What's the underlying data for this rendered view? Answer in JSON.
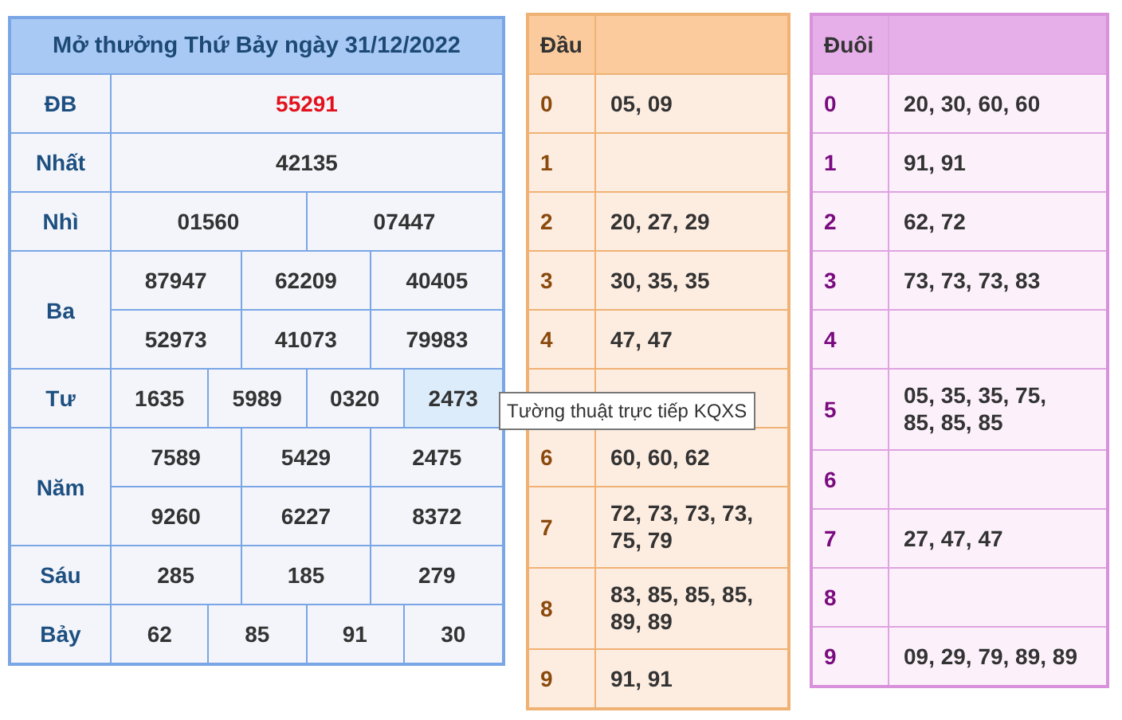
{
  "results": {
    "title": "Mở thưởng Thứ Bảy ngày 31/12/2022",
    "rows": [
      {
        "label": "ĐB",
        "kind": "special",
        "lines": [
          [
            {
              "value": "55291"
            }
          ]
        ]
      },
      {
        "label": "Nhất",
        "kind": "regular",
        "lines": [
          [
            {
              "value": "42135"
            }
          ]
        ]
      },
      {
        "label": "Nhì",
        "kind": "regular",
        "lines": [
          [
            {
              "value": "01560"
            },
            {
              "value": "07447"
            }
          ]
        ]
      },
      {
        "label": "Ba",
        "kind": "regular",
        "lines": [
          [
            {
              "value": "87947"
            },
            {
              "value": "62209"
            },
            {
              "value": "40405"
            }
          ],
          [
            {
              "value": "52973"
            },
            {
              "value": "41073"
            },
            {
              "value": "79983"
            }
          ]
        ]
      },
      {
        "label": "Tư",
        "kind": "regular",
        "lines": [
          [
            {
              "value": "1635",
              "highlighted": false
            },
            {
              "value": "5989",
              "highlighted": false
            },
            {
              "value": "0320",
              "highlighted": false
            },
            {
              "value": "2473",
              "highlighted": true
            }
          ]
        ]
      },
      {
        "label": "Năm",
        "kind": "regular",
        "lines": [
          [
            {
              "value": "7589"
            },
            {
              "value": "5429"
            },
            {
              "value": "2475"
            }
          ],
          [
            {
              "value": "9260"
            },
            {
              "value": "6227"
            },
            {
              "value": "8372"
            }
          ]
        ]
      },
      {
        "label": "Sáu",
        "kind": "regular",
        "lines": [
          [
            {
              "value": "285"
            },
            {
              "value": "185"
            },
            {
              "value": "279"
            }
          ]
        ]
      },
      {
        "label": "Bảy",
        "kind": "regular",
        "lines": [
          [
            {
              "value": "62"
            },
            {
              "value": "85"
            },
            {
              "value": "91"
            },
            {
              "value": "30"
            }
          ]
        ]
      }
    ]
  },
  "loto_tables": [
    {
      "kind": "head",
      "title": "Đầu",
      "rows": [
        {
          "digit": "0",
          "numbers": "05, 09"
        },
        {
          "digit": "1"
        },
        {
          "digit": "2",
          "numbers": "20, 27, 29"
        },
        {
          "digit": "3",
          "numbers": "30, 35, 35"
        },
        {
          "digit": "4",
          "numbers": "47, 47"
        },
        {},
        {
          "digit": "6",
          "numbers": "60, 60, 62"
        },
        {
          "digit": "7",
          "numbers": "72, 73, 73, 73, 75, 79"
        },
        {
          "digit": "8",
          "numbers": "83, 85, 85, 85, 89, 89"
        },
        {
          "digit": "9",
          "numbers": "91, 91"
        }
      ]
    },
    {
      "kind": "tail",
      "title": "Đuôi",
      "rows": [
        {
          "digit": "0",
          "numbers": "20, 30, 60, 60"
        },
        {
          "digit": "1",
          "numbers": "91, 91"
        },
        {
          "digit": "2",
          "numbers": "62, 72"
        },
        {
          "digit": "3",
          "numbers": "73, 73, 73, 83"
        },
        {
          "digit": "4"
        },
        {
          "digit": "5",
          "numbers": "05, 35, 35, 75, 85, 85, 85"
        },
        {
          "digit": "6"
        },
        {
          "digit": "7",
          "numbers": "27, 47, 47"
        },
        {
          "digit": "8"
        },
        {
          "digit": "9",
          "numbers": "09, 29, 79, 89, 89"
        }
      ]
    }
  ],
  "tooltip": {
    "text": "Tường thuật trực tiếp KQXS"
  }
}
